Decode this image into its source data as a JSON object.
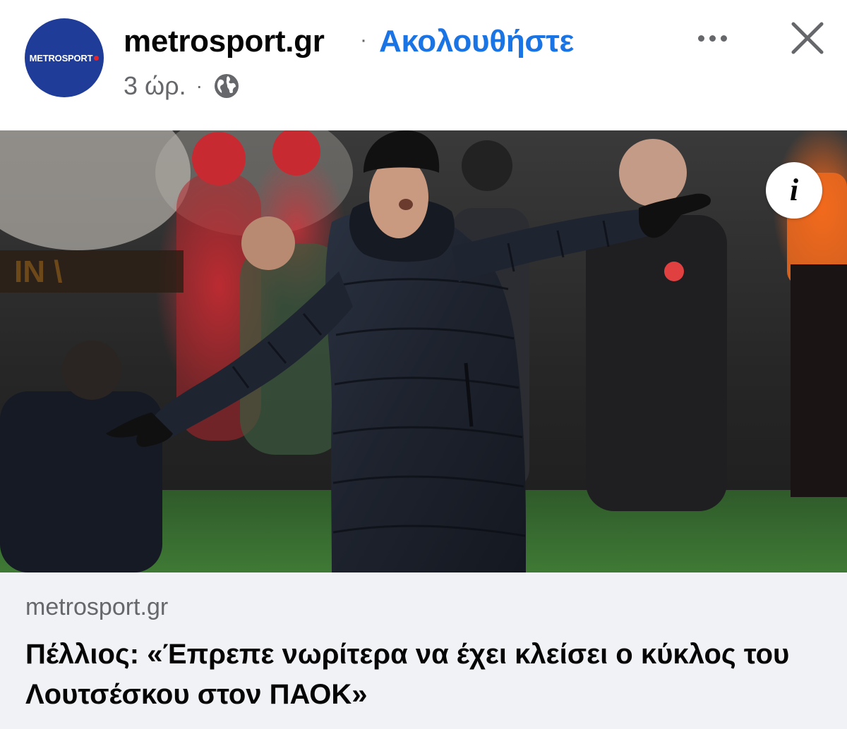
{
  "header": {
    "avatar_text": "METROSPORT",
    "page_name": "metrosport.gr",
    "separator": "·",
    "follow_label": "Ακολουθήστε",
    "timestamp": "3 ώρ.",
    "meta_separator": "·",
    "privacy_icon": "globe-icon",
    "more_icon": "more-options-icon",
    "close_icon": "close-icon"
  },
  "image": {
    "info_icon": "info-icon",
    "info_glyph": "i"
  },
  "link_preview": {
    "domain": "metrosport.gr",
    "title": "Πέλλιος: «Έπρεπε νωρίτερα να έχει κλείσει ο κύκλος του Λουτσέσκου στον ΠΑΟΚ»"
  },
  "colors": {
    "brand_blue": "#1f3c99",
    "follow_blue": "#1b74e4",
    "secondary_text": "#65676b",
    "preview_bg": "#f0f2f5"
  }
}
